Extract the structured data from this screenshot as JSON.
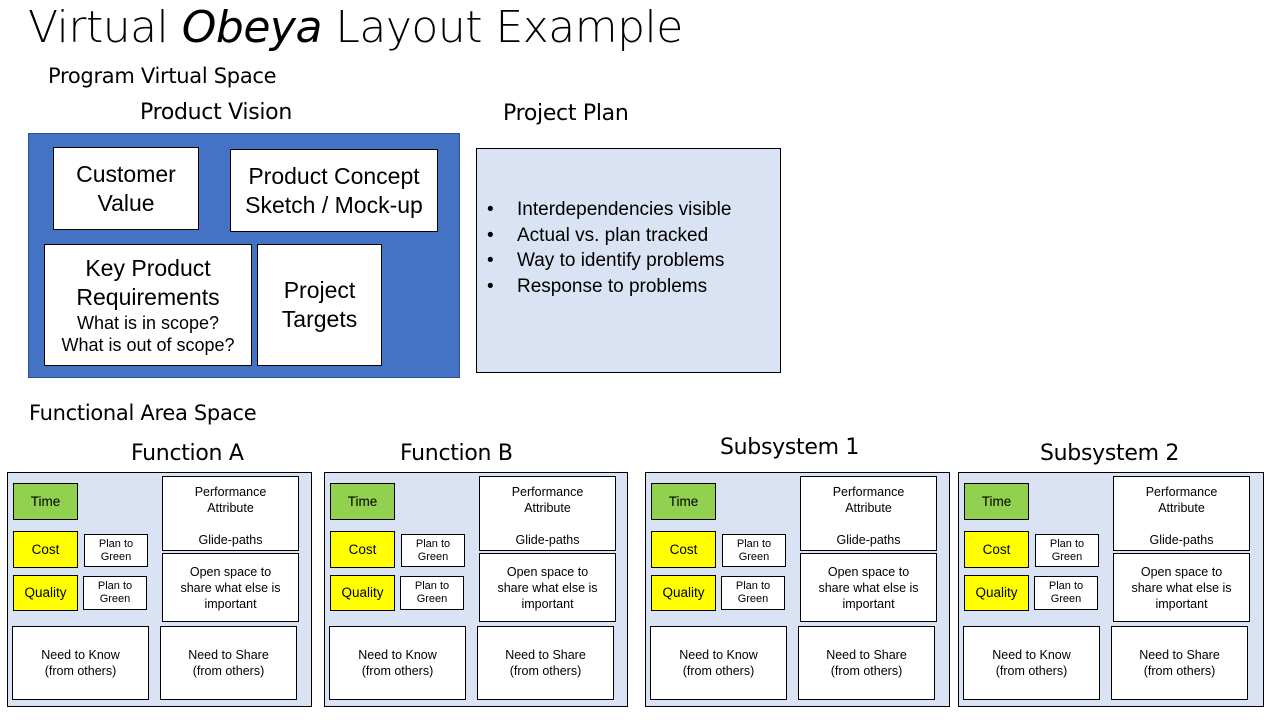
{
  "title": {
    "pre": "Virtual ",
    "italic": "Obeya",
    "post": " Layout Example"
  },
  "program_space": {
    "label": "Program Virtual Space",
    "product_vision": {
      "label": "Product Vision",
      "colors": {
        "background": "#4472c4"
      },
      "boxes": {
        "customer_value": [
          "Customer",
          "Value"
        ],
        "product_concept": [
          "Product Concept",
          "Sketch / Mock-up"
        ],
        "key_requirements": {
          "lines": [
            "Key Product",
            "Requirements"
          ],
          "sub": [
            "What is in scope?",
            "What is out of scope?"
          ]
        },
        "project_targets": [
          "Project",
          "Targets"
        ]
      }
    },
    "project_plan": {
      "label": "Project Plan",
      "bullet": "•",
      "items": [
        "Interdependencies visible",
        "Actual vs. plan tracked",
        "Way to identify problems",
        "Response to problems"
      ]
    }
  },
  "functional_space": {
    "label": "Functional Area Space",
    "colors": {
      "panel": "#dae3f3",
      "green": "#92d050",
      "yellow": "#ffff00"
    },
    "panels": [
      {
        "title": "Function A"
      },
      {
        "title": "Function B"
      },
      {
        "title": "Subsystem 1"
      },
      {
        "title": "Subsystem 2"
      }
    ],
    "cell_text": {
      "time": "Time",
      "cost": "Cost",
      "quality": "Quality",
      "plan_to_green": [
        "Plan to",
        "Green"
      ],
      "performance": [
        "Performance",
        "Attribute",
        "",
        "Glide-paths"
      ],
      "open_space": [
        "Open space to",
        "share what else is",
        "important"
      ],
      "need_know": [
        "Need to Know",
        "(from others)"
      ],
      "need_share": [
        "Need to Share",
        "(from others)"
      ]
    }
  }
}
